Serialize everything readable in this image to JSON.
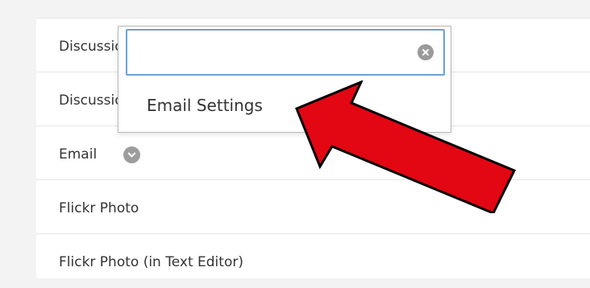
{
  "rows": [
    {
      "label": "Discussion Board"
    },
    {
      "label": "Discussion Board Settings"
    },
    {
      "label": "Email"
    },
    {
      "label": "Flickr Photo"
    },
    {
      "label": "Flickr Photo (in Text Editor)"
    }
  ],
  "dropdown": {
    "search_value": "",
    "search_placeholder": "",
    "options": [
      {
        "label": "Email Settings"
      }
    ]
  },
  "icons": {
    "row_menu": "chevron-down-icon",
    "clear": "clear-icon",
    "annotation": "red-arrow-icon"
  },
  "colors": {
    "focus_border": "#6aa1d8",
    "arrow_fill": "#e30613",
    "chevron_circle": "#9d9d9d"
  }
}
